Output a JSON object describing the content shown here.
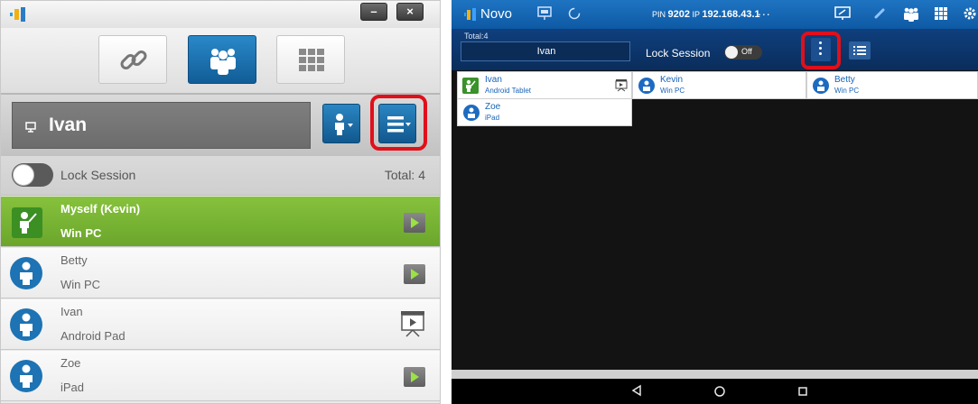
{
  "left_app": {
    "window_controls": {
      "minimize": "–",
      "close": "×"
    },
    "modes": [
      {
        "icon": "link-icon"
      },
      {
        "icon": "people-icon",
        "active": true
      },
      {
        "icon": "grid-icon"
      }
    ],
    "presenter": {
      "name": "Ivan"
    },
    "lock_label": "Lock Session",
    "total": "Total: 4",
    "users": [
      {
        "name": "Myself (Kevin)",
        "device": "Win PC",
        "self": true,
        "action": "play"
      },
      {
        "name": "Betty",
        "device": "Win PC",
        "action": "play"
      },
      {
        "name": "Ivan",
        "device": "Android Pad",
        "action": "presenting"
      },
      {
        "name": "Zoe",
        "device": "iPad",
        "action": "play"
      }
    ],
    "colors": {
      "accent": "#1a70ad",
      "self_green": "#7ab636",
      "highlight": "#e0101b"
    }
  },
  "right_app": {
    "app_name": "Novo",
    "pin_label": "PIN",
    "pin": "9202",
    "ip_label": "IP",
    "ip": "192.168.43.1",
    "more": "...",
    "total": "Total:4",
    "presenter": "Ivan",
    "lock_label": "Lock Session",
    "toggle_state": "Off",
    "cards": [
      {
        "name": "Ivan",
        "device": "Android Tablet",
        "presenting": true
      },
      {
        "name": "Kevin",
        "device": "Win PC"
      },
      {
        "name": "Betty",
        "device": "Win PC"
      },
      {
        "name": "Zoe",
        "device": "iPad"
      }
    ],
    "colors": {
      "statusbar": "#1566b4",
      "toolbar": "#0d3670",
      "highlight": "#e0101b"
    }
  }
}
